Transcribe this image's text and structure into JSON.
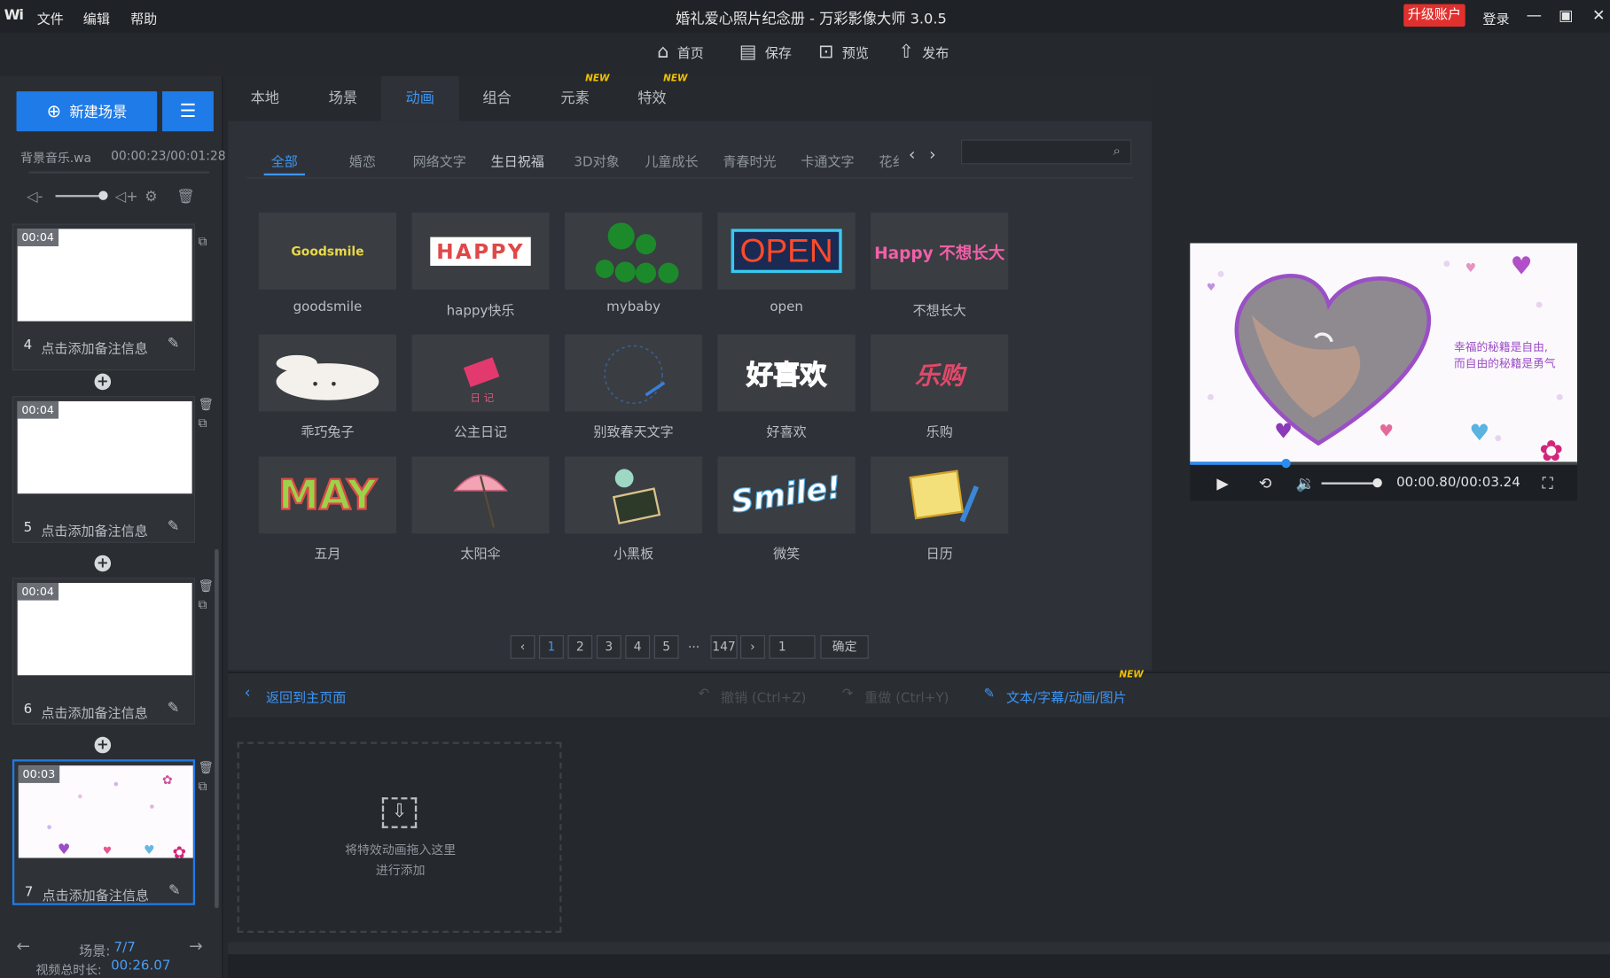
{
  "titlebar": {
    "logo": "Wi",
    "menus": [
      "文件",
      "编辑",
      "帮助"
    ],
    "title": "婚礼爱心照片纪念册 - 万彩影像大师 3.0.5",
    "upgrade": "升级账户",
    "login": "登录"
  },
  "toolbar": {
    "home": "首页",
    "save": "保存",
    "preview": "预览",
    "publish": "发布"
  },
  "left": {
    "new_scene": "新建场景",
    "music_name": "背景音乐.wa",
    "music_time": "00:00:23/00:01:28",
    "scenes": [
      {
        "num": "4",
        "duration": "00:04",
        "note": "点击添加备注信息"
      },
      {
        "num": "5",
        "duration": "00:04",
        "note": "点击添加备注信息"
      },
      {
        "num": "6",
        "duration": "00:04",
        "note": "点击添加备注信息"
      },
      {
        "num": "7",
        "duration": "00:03",
        "note": "点击添加备注信息"
      }
    ],
    "scene_label": "场景:",
    "scene_count": "7/7",
    "total_label": "视频总时长:",
    "total_time": "00:26.07"
  },
  "tabs": [
    "本地",
    "场景",
    "动画",
    "组合",
    "元素",
    "特效"
  ],
  "new_badge": "NEW",
  "subtabs": [
    "全部",
    "婚恋",
    "网络文字",
    "生日祝福",
    "3D对象",
    "儿童成长",
    "青春时光",
    "卡通文字",
    "花纟"
  ],
  "animations": [
    {
      "label": "goodsmile",
      "art": "Goodsmile"
    },
    {
      "label": "happy快乐",
      "art": "HAPPY"
    },
    {
      "label": "mybaby",
      "art": ""
    },
    {
      "label": "open",
      "art": "OPEN"
    },
    {
      "label": "不想长大",
      "art": "Happy 不想长大"
    },
    {
      "label": "乖巧兔子",
      "art": ""
    },
    {
      "label": "公主日记",
      "art": ""
    },
    {
      "label": "别致春天文字",
      "art": ""
    },
    {
      "label": "好喜欢",
      "art": "好喜欢"
    },
    {
      "label": "乐购",
      "art": "乐购"
    },
    {
      "label": "五月",
      "art": "MAY"
    },
    {
      "label": "太阳伞",
      "art": ""
    },
    {
      "label": "小黑板",
      "art": ""
    },
    {
      "label": "微笑",
      "art": "Smile!"
    },
    {
      "label": "日历",
      "art": ""
    }
  ],
  "pagination": {
    "pages": [
      "1",
      "2",
      "3",
      "4",
      "5"
    ],
    "ellipsis": "...",
    "last": "147",
    "input_value": "1",
    "confirm": "确定"
  },
  "editbar": {
    "back": "返回到主页面",
    "undo": "撤销 (Ctrl+Z)",
    "redo": "重做 (Ctrl+Y)",
    "text_tool": "文本/字幕/动画/图片"
  },
  "dropzone": {
    "line1": "将特效动画拖入这里",
    "line2": "进行添加"
  },
  "preview": {
    "caption1": "幸福的秘籍是自由,",
    "caption2": "而自由的秘籍是勇气",
    "time": "00:00.80/00:03.24",
    "progress": 0.25
  },
  "colors": {
    "accent": "#1f7be8",
    "upgrade": "#e0312f",
    "link": "#3d95f2"
  }
}
